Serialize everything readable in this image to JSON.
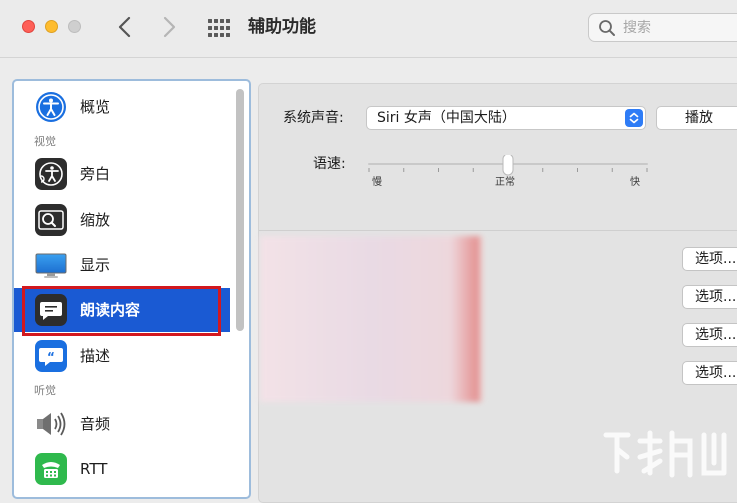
{
  "window": {
    "title": "辅助功能"
  },
  "search": {
    "placeholder": "搜索"
  },
  "sidebar": {
    "items": [
      {
        "label": "概览",
        "icon": "accessibility-icon"
      },
      {
        "label": "旁白",
        "icon": "voiceover-icon"
      },
      {
        "label": "缩放",
        "icon": "zoom-icon"
      },
      {
        "label": "显示",
        "icon": "display-icon"
      },
      {
        "label": "朗读内容",
        "icon": "spoken-content-icon",
        "selected": true
      },
      {
        "label": "描述",
        "icon": "descriptions-icon"
      },
      {
        "label": "音频",
        "icon": "audio-icon"
      },
      {
        "label": "RTT",
        "icon": "rtt-icon"
      }
    ],
    "sections": {
      "vision": "视觉",
      "hearing": "听觉"
    }
  },
  "main": {
    "voice_label": "系统声音:",
    "voice_value": "Siri 女声（中国大陆）",
    "play_label": "播放",
    "rate_label": "语速:",
    "rate_ticks": {
      "slow": "慢",
      "normal": "正常",
      "fast": "快"
    },
    "rate_value_fraction": 0.5,
    "options_buttons": [
      "选项...",
      "选项...",
      "选项...",
      "选项..."
    ]
  },
  "colors": {
    "accent": "#1a5ad3",
    "highlight": "#d2181f"
  }
}
